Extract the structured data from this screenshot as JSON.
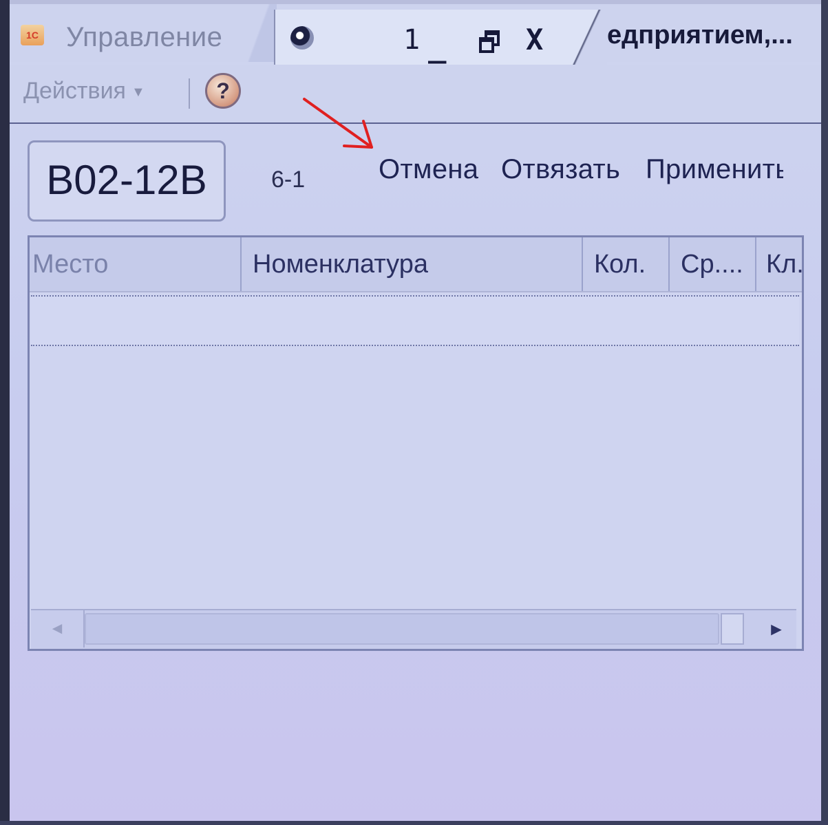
{
  "titlebar": {
    "app_title": "Управление",
    "window_number": "1",
    "minimize_glyph": "_",
    "close_glyph": "X",
    "enterprise_title": "едприятием,..."
  },
  "toolbar": {
    "actions_label": "Действия",
    "help_label": "?"
  },
  "form": {
    "cell_code": "B02-12B",
    "zone": "6-1",
    "cancel_label": "Отмена",
    "unbind_label": "Отвязать",
    "apply_label": "Применить"
  },
  "table": {
    "columns": [
      "Место",
      "Номенклатура",
      "Кол.",
      "Ср....",
      "Кл."
    ]
  },
  "icons": {
    "app": "1c-app-icon",
    "window": "window-icon",
    "help": "help-icon",
    "scroll_left": "◄",
    "scroll_right": "►"
  },
  "colors": {
    "annotation_arrow": "#e02020",
    "text": "#1e2352"
  }
}
